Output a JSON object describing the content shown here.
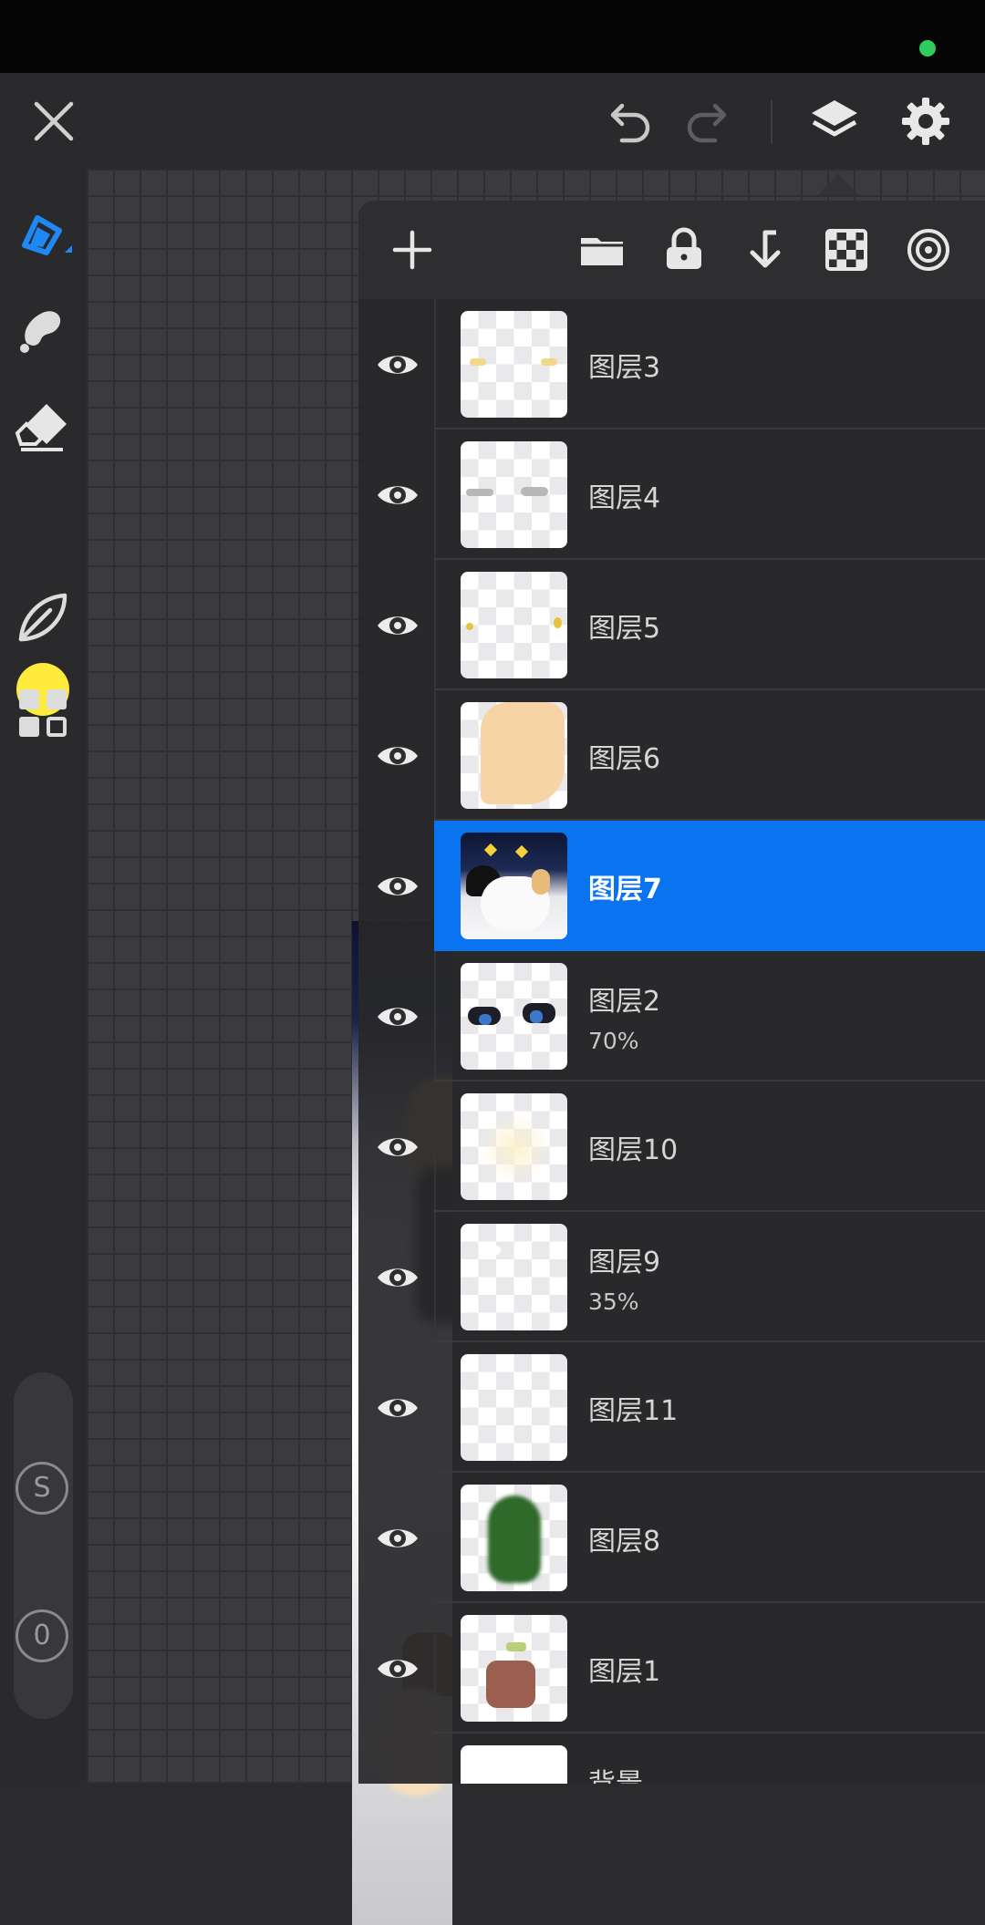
{
  "colors": {
    "accent": "#0a74f0",
    "current_color": "#ffeb3b",
    "status_dot": "#2ecc5a"
  },
  "top_bar": {
    "icons": [
      "close-icon",
      "undo-icon",
      "redo-icon",
      "layers-icon",
      "settings-icon"
    ]
  },
  "left_toolbar": {
    "tools": [
      "brush-icon",
      "smudge-icon",
      "eraser-icon",
      "color-swatch",
      "liquify-icon",
      "gallery-icon"
    ],
    "size_button": "S",
    "opacity_button": "0"
  },
  "layers_panel": {
    "header_icons": [
      "add-layer-icon",
      "folder-icon",
      "lock-icon",
      "merge-down-icon",
      "checkerboard-icon",
      "reference-icon"
    ],
    "layers": [
      {
        "name": "图层3",
        "opacity": "",
        "selected": false
      },
      {
        "name": "图层4",
        "opacity": "",
        "selected": false
      },
      {
        "name": "图层5",
        "opacity": "",
        "selected": false
      },
      {
        "name": "图层6",
        "opacity": "",
        "selected": false
      },
      {
        "name": "图层7",
        "opacity": "",
        "selected": true
      },
      {
        "name": "图层2",
        "opacity": "70%",
        "selected": false
      },
      {
        "name": "图层10",
        "opacity": "",
        "selected": false
      },
      {
        "name": "图层9",
        "opacity": "35%",
        "selected": false
      },
      {
        "name": "图层11",
        "opacity": "",
        "selected": false
      },
      {
        "name": "图层8",
        "opacity": "",
        "selected": false
      },
      {
        "name": "图层1",
        "opacity": "",
        "selected": false
      }
    ],
    "background_layer": {
      "name": "背景"
    }
  }
}
